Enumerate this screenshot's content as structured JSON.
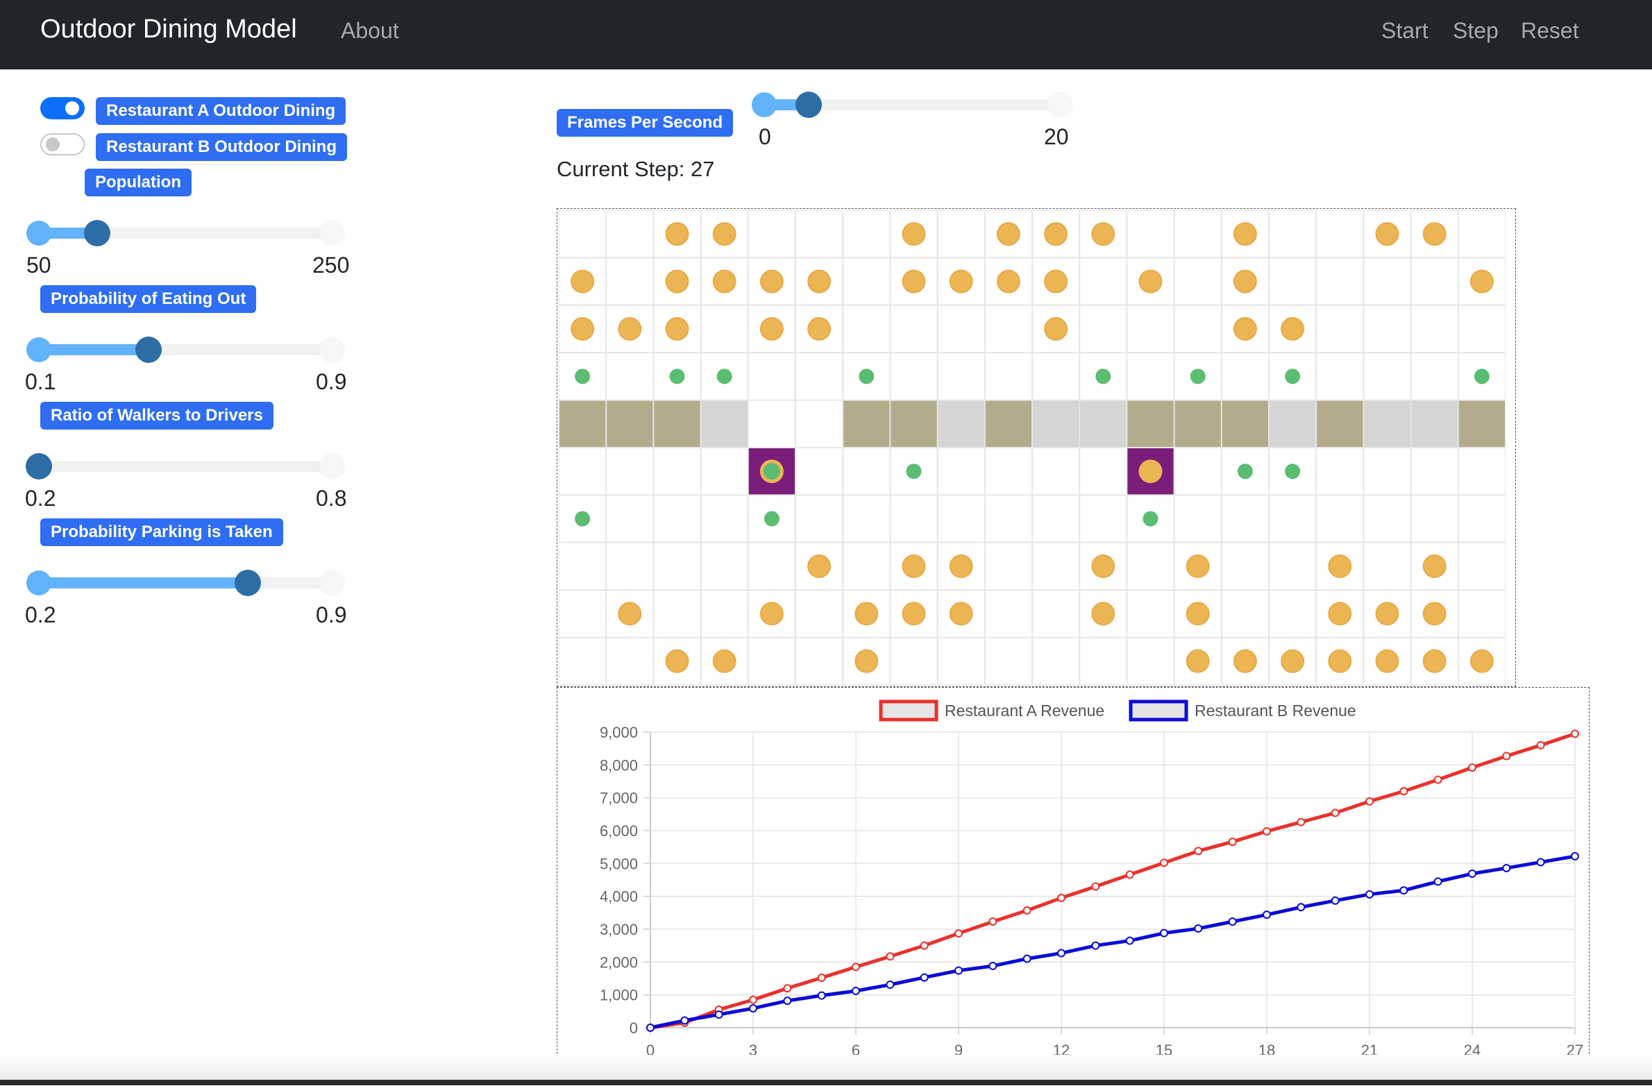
{
  "navbar": {
    "brand": "Outdoor Dining Model",
    "about": "About",
    "start": "Start",
    "step": "Step",
    "reset": "Reset"
  },
  "sidebar": {
    "toggle_a": {
      "label": "Restaurant A Outdoor Dining",
      "checked": true
    },
    "toggle_b": {
      "label": "Restaurant B Outdoor Dining",
      "checked": false
    },
    "population": {
      "label": "Population",
      "min": "50",
      "max": "250",
      "value": 90
    },
    "eating_out": {
      "label": "Probability of Eating Out",
      "min": "0.1",
      "max": "0.9",
      "value": 0.4
    },
    "walkers": {
      "label": "Ratio of Walkers to Drivers",
      "min": "0.2",
      "max": "0.8",
      "value": 0.2
    },
    "parking": {
      "label": "Probability Parking is Taken",
      "min": "0.2",
      "max": "0.9",
      "value": 0.7
    }
  },
  "fps": {
    "label": "Frames Per Second",
    "min": "0",
    "max": "20",
    "value": 3
  },
  "current_step": "Current Step: 27",
  "grid": {
    "columns": 20,
    "rows": 10,
    "colors": {
      "person": "#ecb554",
      "person_border": "#e8aa4a",
      "walker": "#5bbd72",
      "parking_open": "#b2ac8c",
      "parking_light": "#d5d5d5",
      "restaurant": "#7b1e7a",
      "line": "#e6e6e6"
    },
    "people": [
      [
        0,
        2
      ],
      [
        0,
        3
      ],
      [
        0,
        7
      ],
      [
        0,
        9
      ],
      [
        0,
        10
      ],
      [
        0,
        11
      ],
      [
        0,
        14
      ],
      [
        0,
        17
      ],
      [
        0,
        18
      ],
      [
        1,
        0
      ],
      [
        1,
        2
      ],
      [
        1,
        3
      ],
      [
        1,
        4
      ],
      [
        1,
        5
      ],
      [
        1,
        7
      ],
      [
        1,
        8
      ],
      [
        1,
        9
      ],
      [
        1,
        10
      ],
      [
        1,
        12
      ],
      [
        1,
        14
      ],
      [
        1,
        19
      ],
      [
        2,
        0
      ],
      [
        2,
        1
      ],
      [
        2,
        2
      ],
      [
        2,
        4
      ],
      [
        2,
        5
      ],
      [
        2,
        10
      ],
      [
        2,
        14
      ],
      [
        2,
        15
      ],
      [
        7,
        5
      ],
      [
        7,
        7
      ],
      [
        7,
        8
      ],
      [
        7,
        11
      ],
      [
        7,
        13
      ],
      [
        7,
        16
      ],
      [
        7,
        18
      ],
      [
        8,
        1
      ],
      [
        8,
        4
      ],
      [
        8,
        6
      ],
      [
        8,
        7
      ],
      [
        8,
        8
      ],
      [
        8,
        11
      ],
      [
        8,
        13
      ],
      [
        8,
        16
      ],
      [
        8,
        17
      ],
      [
        8,
        18
      ],
      [
        9,
        2
      ],
      [
        9,
        3
      ],
      [
        9,
        6
      ],
      [
        9,
        13
      ],
      [
        9,
        14
      ],
      [
        9,
        15
      ],
      [
        9,
        16
      ],
      [
        9,
        17
      ],
      [
        9,
        18
      ],
      [
        9,
        19
      ]
    ],
    "walkers": [
      [
        3,
        0
      ],
      [
        3,
        2
      ],
      [
        3,
        3
      ],
      [
        3,
        6
      ],
      [
        3,
        11
      ],
      [
        3,
        13
      ],
      [
        3,
        15
      ],
      [
        3,
        19
      ],
      [
        5,
        7
      ],
      [
        5,
        14
      ],
      [
        5,
        15
      ],
      [
        6,
        0
      ],
      [
        6,
        4
      ],
      [
        6,
        12
      ]
    ],
    "road_row": 4,
    "road": [
      "open",
      "open",
      "open",
      "light",
      "empty",
      "empty",
      "open",
      "open",
      "light",
      "open",
      "light",
      "light",
      "open",
      "open",
      "open",
      "light",
      "open",
      "light",
      "light",
      "open"
    ],
    "restaurants": [
      {
        "row": 5,
        "col": 4,
        "occupant": "walker"
      },
      {
        "row": 5,
        "col": 12,
        "occupant": "person"
      }
    ]
  },
  "chart_data": {
    "type": "line",
    "x": [
      0,
      1,
      2,
      3,
      4,
      5,
      6,
      7,
      8,
      9,
      10,
      11,
      12,
      13,
      14,
      15,
      16,
      17,
      18,
      19,
      20,
      21,
      22,
      23,
      24,
      25,
      26,
      27
    ],
    "x_ticks": [
      "0",
      "3",
      "6",
      "9",
      "12",
      "15",
      "18",
      "21",
      "24",
      "27"
    ],
    "y_ticks": [
      "0",
      "1,000",
      "2,000",
      "3,000",
      "4,000",
      "5,000",
      "6,000",
      "7,000",
      "8,000",
      "9,000"
    ],
    "ylim": [
      0,
      9000
    ],
    "series": [
      {
        "name": "Restaurant A Revenue",
        "color": "#e8322d",
        "values": [
          0,
          150,
          550,
          850,
          1200,
          1520,
          1850,
          2170,
          2500,
          2870,
          3230,
          3570,
          3950,
          4300,
          4660,
          5020,
          5380,
          5660,
          5980,
          6260,
          6540,
          6890,
          7200,
          7550,
          7920,
          8270,
          8600,
          8950
        ]
      },
      {
        "name": "Restaurant B Revenue",
        "color": "#0b0bd6",
        "values": [
          0,
          220,
          400,
          590,
          820,
          980,
          1120,
          1310,
          1530,
          1740,
          1880,
          2100,
          2270,
          2500,
          2650,
          2880,
          3020,
          3230,
          3440,
          3670,
          3870,
          4060,
          4180,
          4450,
          4690,
          4860,
          5040,
          5220
        ]
      }
    ],
    "legend_position": "top",
    "grid": true
  }
}
